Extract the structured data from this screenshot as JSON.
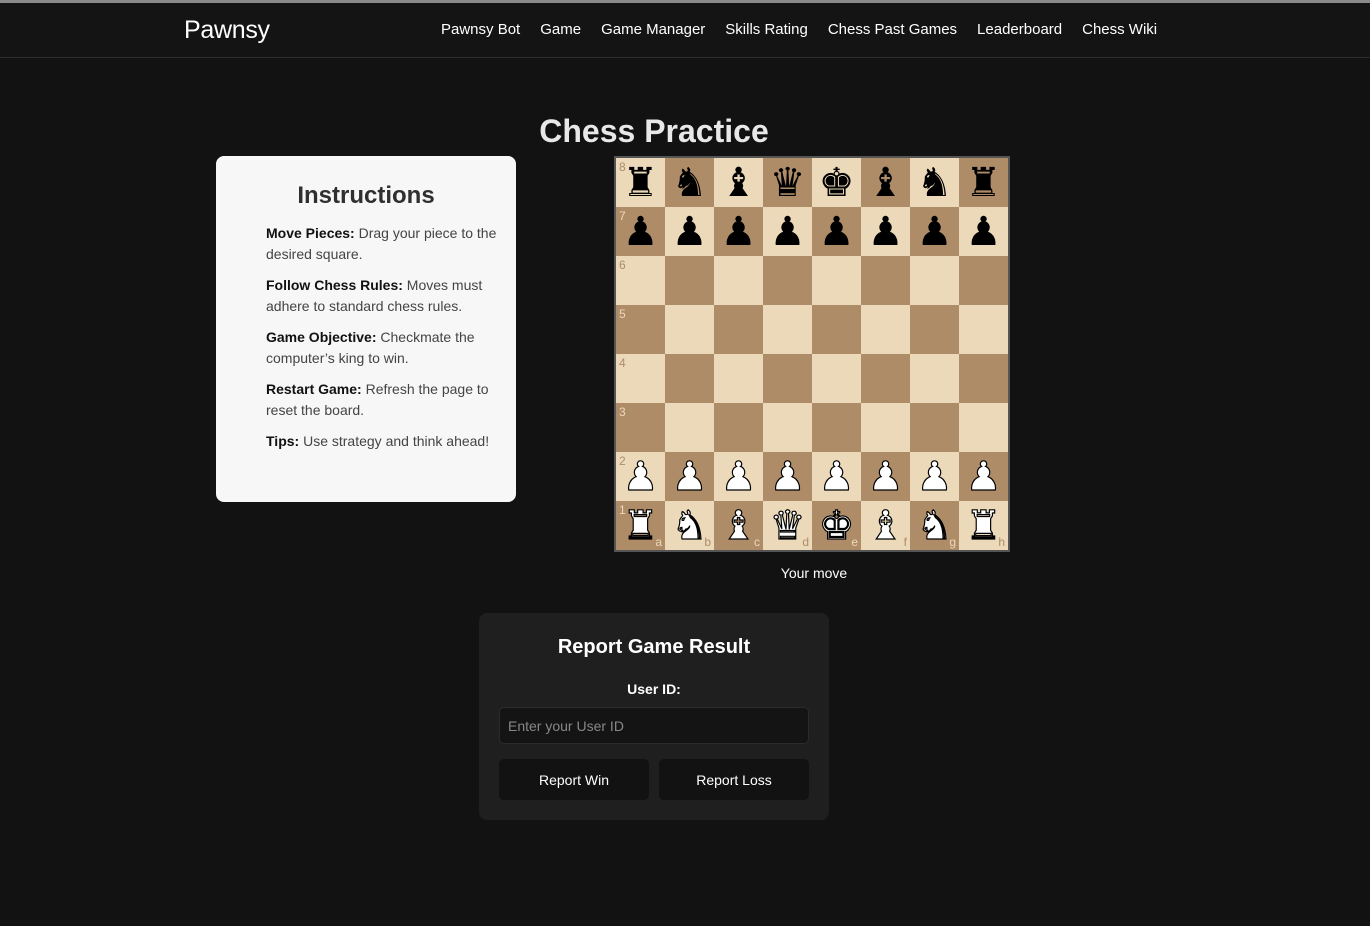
{
  "nav": {
    "brand": "Pawnsy",
    "links": [
      "Pawnsy Bot",
      "Game",
      "Game Manager",
      "Skills Rating",
      "Chess Past Games",
      "Leaderboard",
      "Chess Wiki"
    ]
  },
  "page": {
    "title": "Chess Practice"
  },
  "instructions": {
    "title": "Instructions",
    "items": [
      {
        "label": "Move Pieces:",
        "text": " Drag your piece to the desired square."
      },
      {
        "label": "Follow Chess Rules:",
        "text": " Moves must adhere to standard chess rules."
      },
      {
        "label": "Game Objective:",
        "text": " Checkmate the computer’s king to win."
      },
      {
        "label": "Restart Game:",
        "text": " Refresh the page to reset the board."
      },
      {
        "label": "Tips:",
        "text": " Use strategy and think ahead!"
      }
    ]
  },
  "board": {
    "files": [
      "a",
      "b",
      "c",
      "d",
      "e",
      "f",
      "g",
      "h"
    ],
    "ranks": [
      "8",
      "7",
      "6",
      "5",
      "4",
      "3",
      "2",
      "1"
    ],
    "position": [
      [
        "bR",
        "bN",
        "bB",
        "bQ",
        "bK",
        "bB",
        "bN",
        "bR"
      ],
      [
        "bP",
        "bP",
        "bP",
        "bP",
        "bP",
        "bP",
        "bP",
        "bP"
      ],
      [
        "",
        "",
        "",
        "",
        "",
        "",
        "",
        ""
      ],
      [
        "",
        "",
        "",
        "",
        "",
        "",
        "",
        ""
      ],
      [
        "",
        "",
        "",
        "",
        "",
        "",
        "",
        ""
      ],
      [
        "",
        "",
        "",
        "",
        "",
        "",
        "",
        ""
      ],
      [
        "wP",
        "wP",
        "wP",
        "wP",
        "wP",
        "wP",
        "wP",
        "wP"
      ],
      [
        "wR",
        "wN",
        "wB",
        "wQ",
        "wK",
        "wB",
        "wN",
        "wR"
      ]
    ],
    "colors": {
      "light": "#ecd9b9",
      "dark": "#ae8c68"
    }
  },
  "status": "Your move",
  "report": {
    "title": "Report Game Result",
    "user_id_label": "User ID:",
    "user_id_placeholder": "Enter your User ID",
    "user_id_value": "",
    "win_label": "Report Win",
    "loss_label": "Report Loss"
  }
}
